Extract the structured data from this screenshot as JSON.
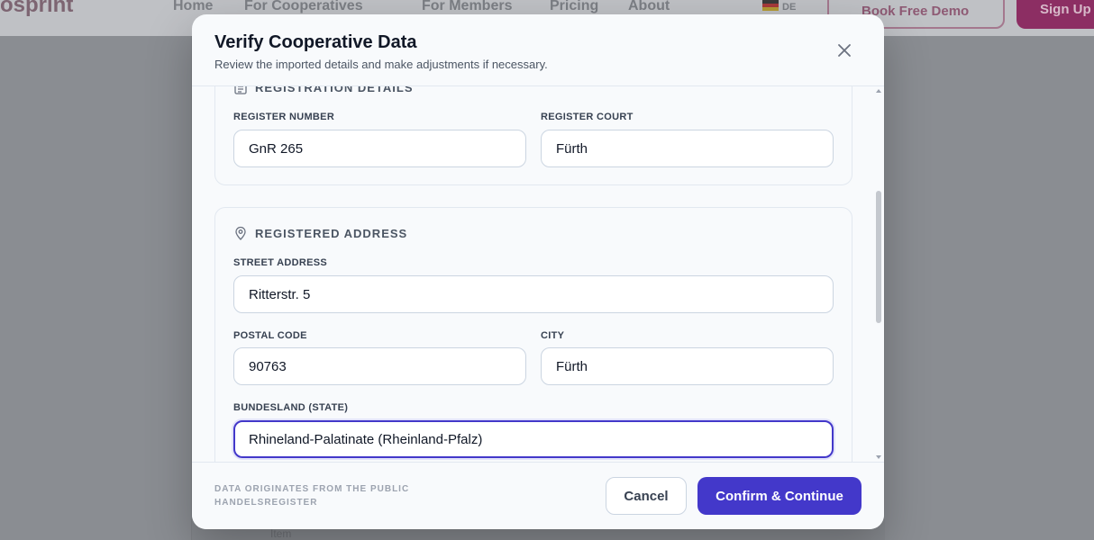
{
  "background": {
    "logo": "osprint",
    "nav": [
      "Home",
      "For Cooperatives",
      "For Members",
      "Pricing",
      "About"
    ],
    "lang": "DE",
    "demo_button": "Book Free Demo",
    "signup_button": "Sign Up",
    "list_item": "Item"
  },
  "modal": {
    "title": "Verify Cooperative Data",
    "subtitle": "Review the imported details and make adjustments if necessary.",
    "registration": {
      "title": "REGISTRATION DETAILS",
      "register_number_label": "REGISTER NUMBER",
      "register_number_value": "GnR 265",
      "register_court_label": "REGISTER COURT",
      "register_court_value": "Fürth"
    },
    "address": {
      "title": "REGISTERED ADDRESS",
      "street_label": "STREET ADDRESS",
      "street_value": "Ritterstr. 5",
      "postal_label": "POSTAL CODE",
      "postal_value": "90763",
      "city_label": "CITY",
      "city_value": "Fürth",
      "state_label": "BUNDESLAND (STATE)",
      "state_value": "Rhineland-Palatinate (Rheinland-Pfalz)"
    },
    "footer": {
      "note": "DATA ORIGINATES FROM THE PUBLIC HANDELSREGISTER",
      "cancel": "Cancel",
      "confirm": "Confirm & Continue"
    }
  },
  "colors": {
    "accent": "#4338ca",
    "overlay": "#8a8d92"
  }
}
